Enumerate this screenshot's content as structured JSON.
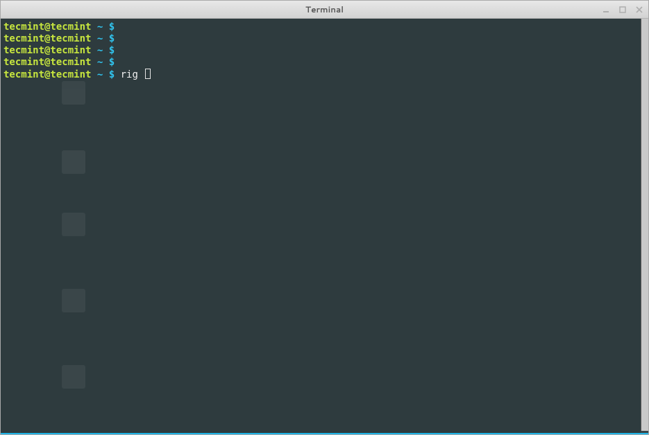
{
  "window": {
    "title": "Terminal"
  },
  "controls": {
    "minimize": "minimize-icon",
    "maximize": "maximize-icon",
    "close": "close-icon"
  },
  "prompt": {
    "user_host": "tecmint@tecmint",
    "path": "~",
    "symbol": "$"
  },
  "lines": [
    {
      "command": ""
    },
    {
      "command": ""
    },
    {
      "command": ""
    },
    {
      "command": ""
    },
    {
      "command": "rig ",
      "cursor": true
    }
  ],
  "colors": {
    "bg": "#2e3b3e",
    "user": "#c7e63e",
    "path": "#31c4ef",
    "text": "#f0f0f0",
    "bottom_border": "#1fb5e8"
  }
}
